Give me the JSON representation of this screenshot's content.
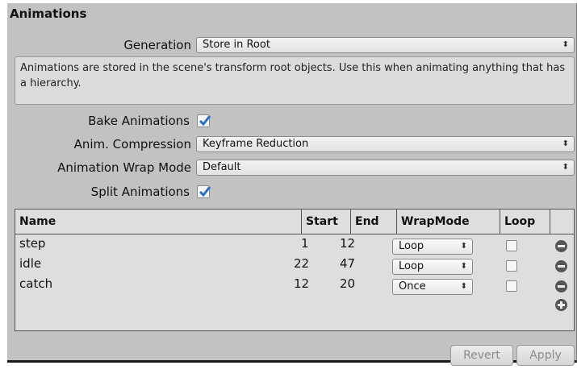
{
  "section": {
    "title": "Animations"
  },
  "generation": {
    "label": "Generation",
    "value": "Store in Root"
  },
  "info": {
    "text": "Animations are stored in the scene's transform root objects. Use this when animating anything that has a hierarchy."
  },
  "bake": {
    "label": "Bake Animations",
    "checked": true
  },
  "compression": {
    "label": "Anim. Compression",
    "value": "Keyframe Reduction"
  },
  "wrap_mode": {
    "label": "Animation Wrap Mode",
    "value": "Default"
  },
  "split": {
    "label": "Split Animations",
    "checked": true
  },
  "table": {
    "headers": {
      "name": "Name",
      "start": "Start",
      "end": "End",
      "wrapmode": "WrapMode",
      "loop": "Loop"
    },
    "rows": [
      {
        "name": "step",
        "start": "1",
        "end": "12",
        "wrapmode": "Loop",
        "loop": false
      },
      {
        "name": "idle",
        "start": "22",
        "end": "47",
        "wrapmode": "Loop",
        "loop": false
      },
      {
        "name": "catch",
        "start": "12",
        "end": "20",
        "wrapmode": "Once",
        "loop": false
      }
    ]
  },
  "buttons": {
    "revert": "Revert",
    "apply": "Apply"
  },
  "icons": {
    "dropdown": "updown-arrows-icon",
    "remove": "remove-circle-icon",
    "add": "add-circle-icon",
    "check": "checkmark-icon"
  },
  "colors": {
    "panel": "#c2c2c2",
    "check": "#2a6fc7"
  }
}
